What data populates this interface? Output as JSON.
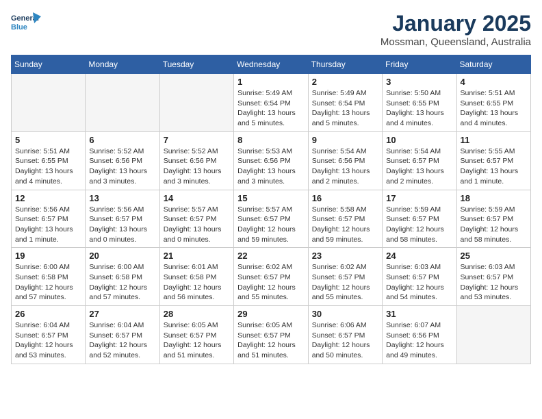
{
  "header": {
    "logo_line1": "General",
    "logo_line2": "Blue",
    "month_year": "January 2025",
    "location": "Mossman, Queensland, Australia"
  },
  "weekdays": [
    "Sunday",
    "Monday",
    "Tuesday",
    "Wednesday",
    "Thursday",
    "Friday",
    "Saturday"
  ],
  "weeks": [
    [
      {
        "day": "",
        "info": ""
      },
      {
        "day": "",
        "info": ""
      },
      {
        "day": "",
        "info": ""
      },
      {
        "day": "1",
        "info": "Sunrise: 5:49 AM\nSunset: 6:54 PM\nDaylight: 13 hours\nand 5 minutes."
      },
      {
        "day": "2",
        "info": "Sunrise: 5:49 AM\nSunset: 6:54 PM\nDaylight: 13 hours\nand 5 minutes."
      },
      {
        "day": "3",
        "info": "Sunrise: 5:50 AM\nSunset: 6:55 PM\nDaylight: 13 hours\nand 4 minutes."
      },
      {
        "day": "4",
        "info": "Sunrise: 5:51 AM\nSunset: 6:55 PM\nDaylight: 13 hours\nand 4 minutes."
      }
    ],
    [
      {
        "day": "5",
        "info": "Sunrise: 5:51 AM\nSunset: 6:55 PM\nDaylight: 13 hours\nand 4 minutes."
      },
      {
        "day": "6",
        "info": "Sunrise: 5:52 AM\nSunset: 6:56 PM\nDaylight: 13 hours\nand 3 minutes."
      },
      {
        "day": "7",
        "info": "Sunrise: 5:52 AM\nSunset: 6:56 PM\nDaylight: 13 hours\nand 3 minutes."
      },
      {
        "day": "8",
        "info": "Sunrise: 5:53 AM\nSunset: 6:56 PM\nDaylight: 13 hours\nand 3 minutes."
      },
      {
        "day": "9",
        "info": "Sunrise: 5:54 AM\nSunset: 6:56 PM\nDaylight: 13 hours\nand 2 minutes."
      },
      {
        "day": "10",
        "info": "Sunrise: 5:54 AM\nSunset: 6:57 PM\nDaylight: 13 hours\nand 2 minutes."
      },
      {
        "day": "11",
        "info": "Sunrise: 5:55 AM\nSunset: 6:57 PM\nDaylight: 13 hours\nand 1 minute."
      }
    ],
    [
      {
        "day": "12",
        "info": "Sunrise: 5:56 AM\nSunset: 6:57 PM\nDaylight: 13 hours\nand 1 minute."
      },
      {
        "day": "13",
        "info": "Sunrise: 5:56 AM\nSunset: 6:57 PM\nDaylight: 13 hours\nand 0 minutes."
      },
      {
        "day": "14",
        "info": "Sunrise: 5:57 AM\nSunset: 6:57 PM\nDaylight: 13 hours\nand 0 minutes."
      },
      {
        "day": "15",
        "info": "Sunrise: 5:57 AM\nSunset: 6:57 PM\nDaylight: 12 hours\nand 59 minutes."
      },
      {
        "day": "16",
        "info": "Sunrise: 5:58 AM\nSunset: 6:57 PM\nDaylight: 12 hours\nand 59 minutes."
      },
      {
        "day": "17",
        "info": "Sunrise: 5:59 AM\nSunset: 6:57 PM\nDaylight: 12 hours\nand 58 minutes."
      },
      {
        "day": "18",
        "info": "Sunrise: 5:59 AM\nSunset: 6:57 PM\nDaylight: 12 hours\nand 58 minutes."
      }
    ],
    [
      {
        "day": "19",
        "info": "Sunrise: 6:00 AM\nSunset: 6:58 PM\nDaylight: 12 hours\nand 57 minutes."
      },
      {
        "day": "20",
        "info": "Sunrise: 6:00 AM\nSunset: 6:58 PM\nDaylight: 12 hours\nand 57 minutes."
      },
      {
        "day": "21",
        "info": "Sunrise: 6:01 AM\nSunset: 6:58 PM\nDaylight: 12 hours\nand 56 minutes."
      },
      {
        "day": "22",
        "info": "Sunrise: 6:02 AM\nSunset: 6:57 PM\nDaylight: 12 hours\nand 55 minutes."
      },
      {
        "day": "23",
        "info": "Sunrise: 6:02 AM\nSunset: 6:57 PM\nDaylight: 12 hours\nand 55 minutes."
      },
      {
        "day": "24",
        "info": "Sunrise: 6:03 AM\nSunset: 6:57 PM\nDaylight: 12 hours\nand 54 minutes."
      },
      {
        "day": "25",
        "info": "Sunrise: 6:03 AM\nSunset: 6:57 PM\nDaylight: 12 hours\nand 53 minutes."
      }
    ],
    [
      {
        "day": "26",
        "info": "Sunrise: 6:04 AM\nSunset: 6:57 PM\nDaylight: 12 hours\nand 53 minutes."
      },
      {
        "day": "27",
        "info": "Sunrise: 6:04 AM\nSunset: 6:57 PM\nDaylight: 12 hours\nand 52 minutes."
      },
      {
        "day": "28",
        "info": "Sunrise: 6:05 AM\nSunset: 6:57 PM\nDaylight: 12 hours\nand 51 minutes."
      },
      {
        "day": "29",
        "info": "Sunrise: 6:05 AM\nSunset: 6:57 PM\nDaylight: 12 hours\nand 51 minutes."
      },
      {
        "day": "30",
        "info": "Sunrise: 6:06 AM\nSunset: 6:57 PM\nDaylight: 12 hours\nand 50 minutes."
      },
      {
        "day": "31",
        "info": "Sunrise: 6:07 AM\nSunset: 6:56 PM\nDaylight: 12 hours\nand 49 minutes."
      },
      {
        "day": "",
        "info": ""
      }
    ]
  ]
}
